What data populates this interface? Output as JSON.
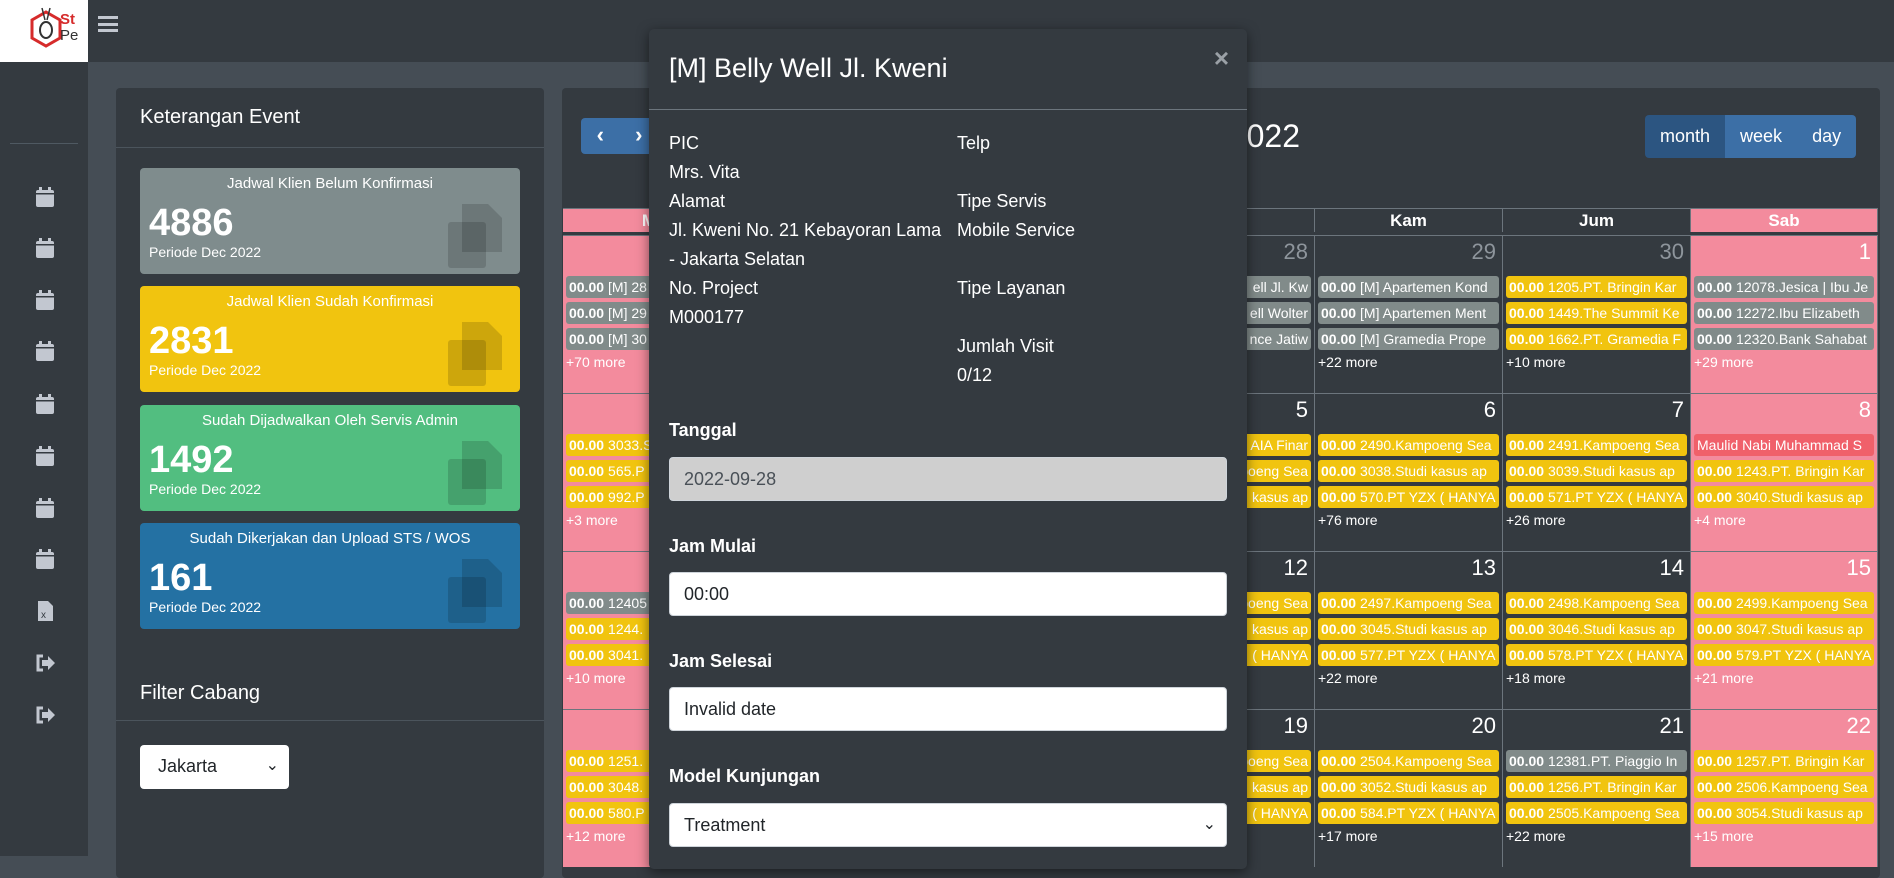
{
  "brand": {
    "line1": "St",
    "line2": "Pe",
    "accent": "#d62b2b"
  },
  "sidebar": {
    "icons": [
      "calendar-icon",
      "calendar-icon",
      "calendar-icon",
      "calendar-icon",
      "calendar-icon",
      "calendar-icon",
      "calendar-icon",
      "calendar-icon",
      "file-excel-icon",
      "sign-out-icon",
      "sign-out-icon"
    ]
  },
  "left": {
    "title": "Keterangan Event",
    "boxes": [
      {
        "title": "Jadwal Klien Belum Konfirmasi",
        "count": "4886",
        "period": "Periode Dec 2022",
        "color": "#7f8c8d"
      },
      {
        "title": "Jadwal Klien Sudah Konfirmasi",
        "count": "2831",
        "period": "Periode Dec 2022",
        "color": "#f1c40f"
      },
      {
        "title": "Sudah Dijadwalkan Oleh Servis Admin",
        "count": "1492",
        "period": "Periode Dec 2022",
        "color": "#52be80"
      },
      {
        "title": "Sudah Dikerjakan dan Upload STS / WOS",
        "count": "161",
        "period": "Periode Dec 2022",
        "color": "#2471a3"
      }
    ],
    "filter_title": "Filter Cabang",
    "branch": "Jakarta"
  },
  "calendar": {
    "prev": "‹",
    "next": "›",
    "title": "2022",
    "views": [
      "month",
      "week",
      "day"
    ],
    "active_view": "month",
    "headers": [
      "Min",
      "",
      "",
      "",
      "Kam",
      "Jum",
      "Sab"
    ],
    "colors": {
      "gray": "#818b8a",
      "yellow": "#f1c40f",
      "red": "#f0606a",
      "weekend": "#f38b9d"
    },
    "weeks": [
      [
        {
          "day": "",
          "events": [
            {
              "t": "00.00",
              "x": "[M] 28",
              "c": "gray"
            },
            {
              "t": "00.00",
              "x": "[M] 29",
              "c": "gray"
            },
            {
              "t": "00.00",
              "x": "[M] 30",
              "c": "gray"
            }
          ],
          "more": "+70 more"
        },
        null,
        null,
        {
          "day": "28",
          "other": true,
          "frag": true,
          "events": [
            {
              "x": "ell Jl. Kw",
              "c": "gray"
            },
            {
              "x": "ell Wolter",
              "c": "gray"
            },
            {
              "x": "nce Jatiw",
              "c": "gray"
            }
          ]
        },
        {
          "day": "29",
          "other": true,
          "events": [
            {
              "t": "00.00",
              "x": "[M] Apartemen Kond",
              "c": "gray"
            },
            {
              "t": "00.00",
              "x": "[M] Apartemen Ment",
              "c": "gray"
            },
            {
              "t": "00.00",
              "x": "[M] Gramedia Prope",
              "c": "gray"
            }
          ],
          "more": "+22 more"
        },
        {
          "day": "30",
          "other": true,
          "events": [
            {
              "t": "00.00",
              "x": "1205.PT. Bringin Kar",
              "c": "yellow"
            },
            {
              "t": "00.00",
              "x": "1449.The Summit Ke",
              "c": "yellow"
            },
            {
              "t": "00.00",
              "x": "1662.PT. Gramedia F",
              "c": "yellow"
            }
          ],
          "more": "+10 more"
        },
        {
          "day": "1",
          "events": [
            {
              "t": "00.00",
              "x": "12078.Jesica | Ibu Je",
              "c": "gray"
            },
            {
              "t": "00.00",
              "x": "12272.Ibu Elizabeth",
              "c": "gray"
            },
            {
              "t": "00.00",
              "x": "12320.Bank Sahabat",
              "c": "gray"
            }
          ],
          "more": "+29 more"
        }
      ],
      [
        {
          "day": "",
          "events": [
            {
              "t": "00.00",
              "x": "3033.S",
              "c": "yellow"
            },
            {
              "t": "00.00",
              "x": "565.P",
              "c": "yellow"
            },
            {
              "t": "00.00",
              "x": "992.P",
              "c": "yellow"
            }
          ],
          "more": "+3 more"
        },
        null,
        null,
        {
          "day": "5",
          "frag": true,
          "events": [
            {
              "x": "AIA Finar",
              "c": "yellow"
            },
            {
              "x": "poeng Sea",
              "c": "yellow"
            },
            {
              "x": "kasus ap",
              "c": "yellow"
            }
          ]
        },
        {
          "day": "6",
          "events": [
            {
              "t": "00.00",
              "x": "2490.Kampoeng Sea",
              "c": "yellow"
            },
            {
              "t": "00.00",
              "x": "3038.Studi kasus ap",
              "c": "yellow"
            },
            {
              "t": "00.00",
              "x": "570.PT YZX ( HANYA",
              "c": "yellow"
            }
          ],
          "more": "+76 more"
        },
        {
          "day": "7",
          "events": [
            {
              "t": "00.00",
              "x": "2491.Kampoeng Sea",
              "c": "yellow"
            },
            {
              "t": "00.00",
              "x": "3039.Studi kasus ap",
              "c": "yellow"
            },
            {
              "t": "00.00",
              "x": "571.PT YZX ( HANYA",
              "c": "yellow"
            }
          ],
          "more": "+26 more"
        },
        {
          "day": "8",
          "events": [
            {
              "x": "Maulid Nabi Muhammad S",
              "c": "red"
            },
            {
              "t": "00.00",
              "x": "1243.PT. Bringin Kar",
              "c": "yellow"
            },
            {
              "t": "00.00",
              "x": "3040.Studi kasus ap",
              "c": "yellow"
            }
          ],
          "more": "+4 more"
        }
      ],
      [
        {
          "day": "",
          "events": [
            {
              "t": "00.00",
              "x": "12405",
              "c": "gray"
            },
            {
              "t": "00.00",
              "x": "1244.",
              "c": "yellow"
            },
            {
              "t": "00.00",
              "x": "3041.",
              "c": "yellow"
            }
          ],
          "more": "+10 more"
        },
        null,
        null,
        {
          "day": "12",
          "frag": true,
          "events": [
            {
              "x": "poeng Sea",
              "c": "yellow"
            },
            {
              "x": "kasus ap",
              "c": "yellow"
            },
            {
              "x": "( HANYA",
              "c": "yellow"
            }
          ]
        },
        {
          "day": "13",
          "events": [
            {
              "t": "00.00",
              "x": "2497.Kampoeng Sea",
              "c": "yellow"
            },
            {
              "t": "00.00",
              "x": "3045.Studi kasus ap",
              "c": "yellow"
            },
            {
              "t": "00.00",
              "x": "577.PT YZX ( HANYA",
              "c": "yellow"
            }
          ],
          "more": "+22 more"
        },
        {
          "day": "14",
          "events": [
            {
              "t": "00.00",
              "x": "2498.Kampoeng Sea",
              "c": "yellow"
            },
            {
              "t": "00.00",
              "x": "3046.Studi kasus ap",
              "c": "yellow"
            },
            {
              "t": "00.00",
              "x": "578.PT YZX ( HANYA",
              "c": "yellow"
            }
          ],
          "more": "+18 more"
        },
        {
          "day": "15",
          "events": [
            {
              "t": "00.00",
              "x": "2499.Kampoeng Sea",
              "c": "yellow"
            },
            {
              "t": "00.00",
              "x": "3047.Studi kasus ap",
              "c": "yellow"
            },
            {
              "t": "00.00",
              "x": "579.PT YZX ( HANYA",
              "c": "yellow"
            }
          ],
          "more": "+21 more"
        }
      ],
      [
        {
          "day": "",
          "events": [
            {
              "t": "00.00",
              "x": "1251.",
              "c": "yellow"
            },
            {
              "t": "00.00",
              "x": "3048.",
              "c": "yellow"
            },
            {
              "t": "00.00",
              "x": "580.P",
              "c": "yellow"
            }
          ],
          "more": "+12 more"
        },
        null,
        null,
        {
          "day": "19",
          "frag": true,
          "events": [
            {
              "x": "poeng Sea",
              "c": "yellow"
            },
            {
              "x": "kasus ap",
              "c": "yellow"
            },
            {
              "x": "( HANYA",
              "c": "yellow"
            }
          ]
        },
        {
          "day": "20",
          "events": [
            {
              "t": "00.00",
              "x": "2504.Kampoeng Sea",
              "c": "yellow"
            },
            {
              "t": "00.00",
              "x": "3052.Studi kasus ap",
              "c": "yellow"
            },
            {
              "t": "00.00",
              "x": "584.PT YZX ( HANYA",
              "c": "yellow"
            }
          ],
          "more": "+17 more"
        },
        {
          "day": "21",
          "events": [
            {
              "t": "00.00",
              "x": "12381.PT. Piaggio In",
              "c": "gray"
            },
            {
              "t": "00.00",
              "x": "1256.PT. Bringin Kar",
              "c": "yellow"
            },
            {
              "t": "00.00",
              "x": "2505.Kampoeng Sea",
              "c": "yellow"
            }
          ],
          "more": "+22 more"
        },
        {
          "day": "22",
          "events": [
            {
              "t": "00.00",
              "x": "1257.PT. Bringin Kar",
              "c": "yellow"
            },
            {
              "t": "00.00",
              "x": "2506.Kampoeng Sea",
              "c": "yellow"
            },
            {
              "t": "00.00",
              "x": "3054.Studi kasus ap",
              "c": "yellow"
            }
          ],
          "more": "+15 more"
        }
      ]
    ]
  },
  "modal": {
    "title": "[M] Belly Well Jl. Kweni",
    "close": "×",
    "pic_label": "PIC",
    "pic": "Mrs. Vita",
    "alamat_label": "Alamat",
    "alamat1": "Jl. Kweni No. 21 Kebayoran Lama",
    "alamat2": "- Jakarta Selatan",
    "project_label": "No. Project",
    "project": "M000177",
    "telp_label": "Telp",
    "servis_label": "Tipe Servis",
    "servis": "Mobile Service",
    "layanan_label": "Tipe Layanan",
    "visit_label": "Jumlah Visit",
    "visit": "0/12",
    "tanggal_label": "Tanggal",
    "tanggal": "2022-09-28",
    "mulai_label": "Jam Mulai",
    "mulai": "00:00",
    "selesai_label": "Jam Selesai",
    "selesai": "Invalid date",
    "model_label": "Model Kunjungan",
    "model": "Treatment"
  }
}
